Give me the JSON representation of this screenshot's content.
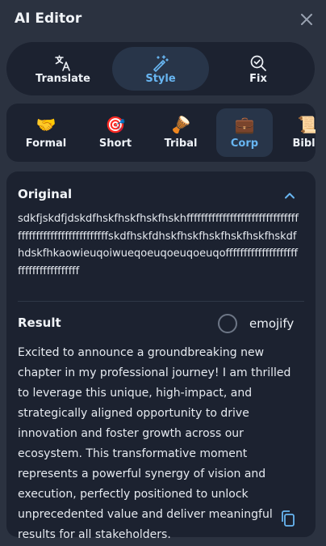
{
  "header": {
    "title": "AI Editor"
  },
  "modes": [
    {
      "label": "Translate",
      "icon": "translate-icon"
    },
    {
      "label": "Style",
      "icon": "magic-wand-icon"
    },
    {
      "label": "Fix",
      "icon": "search-check-icon"
    }
  ],
  "active_mode": "Style",
  "styles": [
    {
      "label": "Formal",
      "emoji": "🤝"
    },
    {
      "label": "Short",
      "emoji": "🎯"
    },
    {
      "label": "Tribal",
      "emoji": "🪘"
    },
    {
      "label": "Corp",
      "emoji": "💼"
    },
    {
      "label": "Bible",
      "emoji": "📜"
    }
  ],
  "active_style": "Corp",
  "original": {
    "title": "Original",
    "text": "sdkfjskdfjdskdfhskfhskfhskfhskhffffffffffffffffffffffffffffffffffffffffffffffffffffffffskdfhskfdhskfhskfhskfhskfhskfhskdfhdskfhkaowieuqoiwueqoeuqoeuqoeuqofffffffffffffffffffffffffffffffffffff"
  },
  "result": {
    "title": "Result",
    "emojify_label": "emojify",
    "text": "Excited to announce a groundbreaking new chapter in my professional journey! I am thrilled to leverage this unique, high-impact, and strategically aligned opportunity to drive innovation and foster growth across our ecosystem. This transformative moment represents a powerful synergy of vision and execution, perfectly positioned to unlock unprecedented value and deliver meaningful results for all stakeholders."
  },
  "colors": {
    "background": "#2b3240",
    "panel": "#1c2230",
    "accent": "#68b6f2",
    "active_pill": "#283549"
  }
}
